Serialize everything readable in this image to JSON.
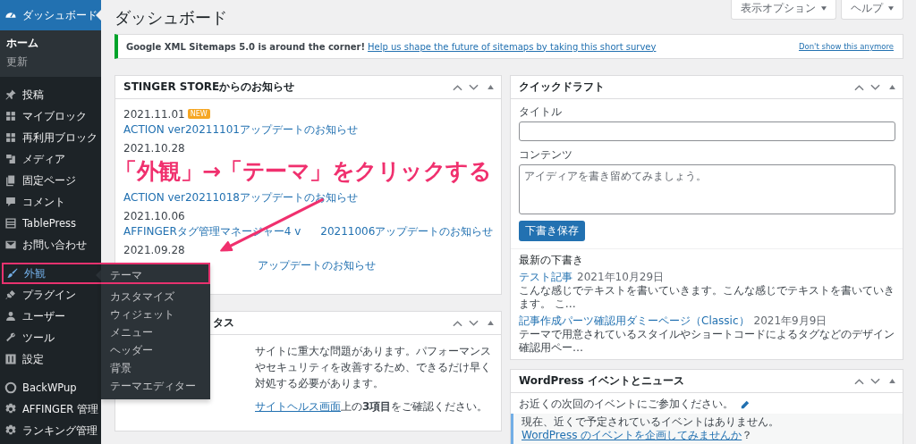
{
  "sidebar": {
    "groups": [
      [
        {
          "label": "ダッシュボード",
          "selected": true,
          "open": false,
          "submenu": [
            {
              "label": "ホーム",
              "selected": true
            },
            {
              "label": "更新",
              "selected": false
            }
          ]
        }
      ],
      [
        {
          "label": "投稿",
          "selected": false,
          "open": false
        },
        {
          "label": "マイブロック",
          "selected": false,
          "open": false
        },
        {
          "label": "再利用ブロック",
          "selected": false,
          "open": false
        },
        {
          "label": "メディア",
          "selected": false,
          "open": false
        },
        {
          "label": "固定ページ",
          "selected": false,
          "open": false
        },
        {
          "label": "コメント",
          "selected": false,
          "open": false
        },
        {
          "label": "TablePress",
          "selected": false,
          "open": false
        },
        {
          "label": "お問い合わせ",
          "selected": false,
          "open": false
        }
      ],
      [
        {
          "label": "外観",
          "selected": false,
          "open": true,
          "submenu": [
            {
              "label": "テーマ",
              "selected": false
            },
            {
              "label": "カスタマイズ",
              "selected": false
            },
            {
              "label": "ウィジェット",
              "selected": false
            },
            {
              "label": "メニュー",
              "selected": false
            },
            {
              "label": "ヘッダー",
              "selected": false
            },
            {
              "label": "背景",
              "selected": false
            },
            {
              "label": "テーマエディター",
              "selected": false
            }
          ]
        },
        {
          "label": "プラグイン",
          "selected": false,
          "open": false
        },
        {
          "label": "ユーザー",
          "selected": false,
          "open": false
        },
        {
          "label": "ツール",
          "selected": false,
          "open": false
        },
        {
          "label": "設定",
          "selected": false,
          "open": false
        }
      ],
      [
        {
          "label": "BackWPup",
          "selected": false,
          "open": false
        },
        {
          "label": "AFFINGER 管理",
          "selected": false,
          "open": false
        },
        {
          "label": "ランキング管理",
          "selected": false,
          "open": false
        }
      ]
    ]
  },
  "page_title": "ダッシュボード",
  "screen_buttons": [
    "表示オプション",
    "ヘルプ"
  ],
  "notice": {
    "text": "Google XML Sitemaps 5.0 is around the corner!",
    "link": "Help us shape the future of sitemaps by taking this short survey",
    "dismiss": "Don't show this anymore"
  },
  "news_panel": {
    "title": "STINGER STOREからのお知らせ",
    "items": [
      {
        "date": "2021.11.01",
        "badge": "NEW",
        "link": "ACTION ver20211101アップデートのお知らせ"
      },
      {
        "date": "2021.10.28"
      },
      {
        "link": "ACTION ver20211018アップデートのお知らせ"
      },
      {
        "date": "2021.10.06",
        "link": "AFFINGERタグ管理マネージャー4 v",
        "link_rest": "20211006アップデートのお知らせ"
      },
      {
        "date": "2021.09.28",
        "link": "アップデートのお知らせ"
      }
    ]
  },
  "health_panel": {
    "title": "タス",
    "text": "サイトに重大な問題があります。パフォーマンスやセキュリティを改善するため、できるだけ早く対処する必要があります。",
    "link": "サイトヘルス画面",
    "after": "上の**3項目**をご確認ください。"
  },
  "quick_draft": {
    "title": "クイックドラフト",
    "title_label": "タイトル",
    "content_label": "コンテンツ",
    "content_placeholder": "アイディアを書き留めてみましょう。",
    "save_button": "下書き保存",
    "drafts_heading": "最新の下書き",
    "drafts": [
      {
        "title": "テスト記事",
        "date": "2021年10月29日",
        "excerpt": "こんな感じでテキストを書いていきます。こんな感じでテキストを書いていきます。 こ…"
      },
      {
        "title": "記事作成パーツ確認用ダミーページ（Classic）",
        "date": "2021年9月9日",
        "excerpt": "テーマで用意されているスタイルやショートコードによるタグなどのデザイン確認用ペー…"
      }
    ]
  },
  "events_panel": {
    "title": "WordPress イベントとニュース",
    "intro": "お近くの次回のイベントにご参加ください。",
    "notice": "現在、近くで予定されているイベントはありません。",
    "notice_link": "WordPress のイベントを企画してみませんか",
    "notice_after": "？"
  },
  "annotation": {
    "text": "「外観」→「テーマ」をクリックする"
  }
}
